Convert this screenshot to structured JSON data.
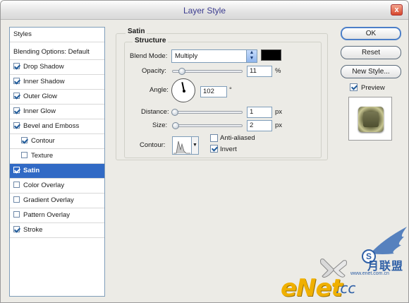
{
  "window": {
    "title": "Layer Style",
    "close_glyph": "x"
  },
  "styles_list": {
    "header": "Styles",
    "blending_options": "Blending Options: Default",
    "items": [
      {
        "label": "Drop Shadow",
        "checked": true
      },
      {
        "label": "Inner Shadow",
        "checked": true
      },
      {
        "label": "Outer Glow",
        "checked": true
      },
      {
        "label": "Inner Glow",
        "checked": true
      },
      {
        "label": "Bevel and Emboss",
        "checked": true
      },
      {
        "label": "Contour",
        "checked": true,
        "indent": true
      },
      {
        "label": "Texture",
        "checked": false,
        "indent": true
      },
      {
        "label": "Satin",
        "checked": true,
        "selected": true
      },
      {
        "label": "Color Overlay",
        "checked": false
      },
      {
        "label": "Gradient Overlay",
        "checked": false
      },
      {
        "label": "Pattern Overlay",
        "checked": false
      },
      {
        "label": "Stroke",
        "checked": true
      }
    ]
  },
  "satin": {
    "group_title": "Satin",
    "structure_title": "Structure",
    "blend_mode_label": "Blend Mode:",
    "blend_mode_value": "Multiply",
    "blend_color": "#000000",
    "opacity_label": "Opacity:",
    "opacity_value": "11",
    "opacity_unit": "%",
    "angle_label": "Angle:",
    "angle_value": "102",
    "angle_unit": "°",
    "distance_label": "Distance:",
    "distance_value": "1",
    "distance_unit": "px",
    "size_label": "Size:",
    "size_value": "2",
    "size_unit": "px",
    "contour_label": "Contour:",
    "anti_aliased_label": "Anti-aliased",
    "anti_aliased_checked": false,
    "invert_label": "Invert",
    "invert_checked": true
  },
  "actions": {
    "ok_label": "OK",
    "reset_label": "Reset",
    "new_style_label": "New Style...",
    "preview_label": "Preview",
    "preview_checked": true
  },
  "watermark": {
    "brand": "eNet",
    "domain_suffix": ".cc",
    "cn_text": "月联盟",
    "s_badge": "S",
    "url": "www.enet.com.cn"
  }
}
